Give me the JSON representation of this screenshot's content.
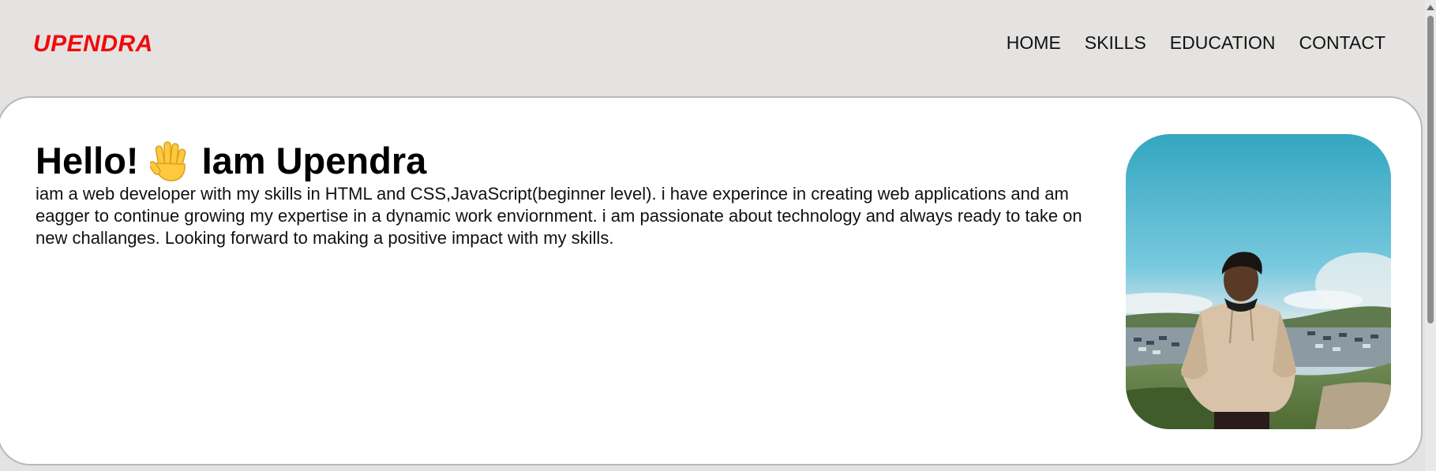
{
  "header": {
    "logo": "UPENDRA",
    "nav_items": [
      {
        "label": "HOME"
      },
      {
        "label": "SKILLS"
      },
      {
        "label": "EDUCATION"
      },
      {
        "label": "CONTACT"
      }
    ]
  },
  "hero": {
    "greeting": "Hello!",
    "name_intro": "Iam Upendra",
    "description": "iam a web developer with my skills in HTML and CSS,JavaScript(beginner level). i have experince in creating web applications and am eagger to continue growing my expertise in a dynamic work enviornment. i am passionate about technology and always ready to take on new challanges. Looking forward to making a positive impact with my skills.",
    "greeting_icon": "raised-hand-icon"
  },
  "colors": {
    "logo": "#f20a0a",
    "page_background": "#e4e3e2",
    "card_background": "#ffffff"
  }
}
